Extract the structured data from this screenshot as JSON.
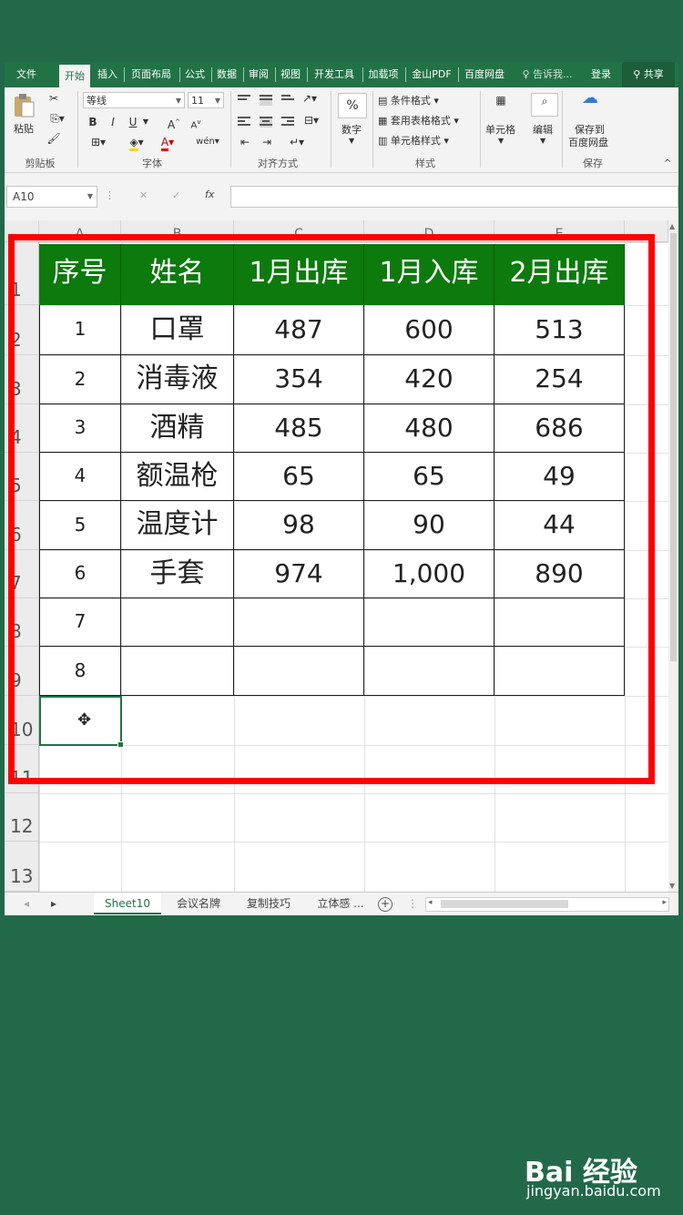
{
  "ribbon": {
    "tabs": [
      "文件",
      "开始",
      "插入",
      "页面布局",
      "公式",
      "数据",
      "审阅",
      "视图",
      "开发工具",
      "加载项",
      "金山PDF",
      "百度网盘"
    ],
    "tell_me": "告诉我...",
    "login": "登录",
    "share": "共享",
    "paste_label": "粘贴",
    "font_name": "等线",
    "font_size": "11",
    "percent_glyph": "%",
    "number_label": "数字",
    "conditional_format": "条件格式",
    "table_format": "套用表格格式",
    "cell_style": "单元格样式",
    "cells_label": "单元格",
    "edit_label": "编辑",
    "save_baidu_line1": "保存到",
    "save_baidu_line2": "百度网盘",
    "groups": {
      "clipboard": "剪贴板",
      "font": "字体",
      "alignment": "对齐方式",
      "styles": "样式",
      "save": "保存"
    },
    "bold": "B",
    "italic": "I",
    "underline": "U"
  },
  "formula_bar": {
    "name_box": "A10",
    "fx": "fx",
    "cancel": "✕",
    "confirm": "✓",
    "value": ""
  },
  "grid": {
    "columns": [
      "A",
      "B",
      "C",
      "D",
      "E"
    ],
    "rows": [
      "1",
      "2",
      "3",
      "4",
      "5",
      "6",
      "7",
      "8",
      "9",
      "10",
      "11",
      "12",
      "13"
    ],
    "headers": [
      "序号",
      "姓名",
      "1月出库",
      "1月入库",
      "2月出库"
    ],
    "data": [
      [
        "1",
        "口罩",
        "487",
        "600",
        "513"
      ],
      [
        "2",
        "消毒液",
        "354",
        "420",
        "254"
      ],
      [
        "3",
        "酒精",
        "485",
        "480",
        "686"
      ],
      [
        "4",
        "额温枪",
        "65",
        "65",
        "49"
      ],
      [
        "5",
        "温度计",
        "98",
        "90",
        "44"
      ],
      [
        "6",
        "手套",
        "974",
        "1,000",
        "890"
      ],
      [
        "7",
        "",
        "",
        "",
        ""
      ],
      [
        "8",
        "",
        "",
        "",
        ""
      ]
    ],
    "selected_cell": "A10"
  },
  "sheets": {
    "tabs": [
      "Sheet10",
      "会议名牌",
      "复制技巧",
      "立体感 ..."
    ],
    "active": "Sheet10",
    "add": "+"
  },
  "watermark": {
    "brand": "Bai 经验",
    "url": "jingyan.baidu.com"
  },
  "colors": {
    "background": "#22694a",
    "excel_green": "#217346",
    "header_fill": "#0c7a0c",
    "highlight_border": "#ff0000"
  }
}
